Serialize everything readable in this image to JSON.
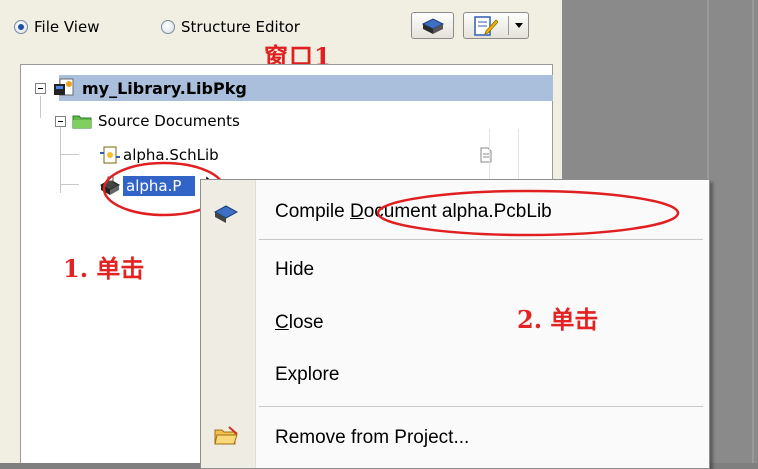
{
  "view_options": {
    "file_view_label": "File View",
    "structure_editor_label": "Structure Editor",
    "selected": "File View"
  },
  "annotations": {
    "window_label": "窗口1",
    "step1": "1. 单击",
    "step2": "2. 单击"
  },
  "tree": {
    "project": "my_Library.LibPkg",
    "folder": "Source Documents",
    "files": [
      {
        "name": "alpha.SchLib",
        "icon": "schlib-icon"
      },
      {
        "name": "alpha.P",
        "icon": "pcblib-icon",
        "selected": true
      }
    ]
  },
  "context_menu": {
    "compile": {
      "prefix": "Compile ",
      "accel": "D",
      "rest": "ocument alpha.PcbLib"
    },
    "hide": "Hide",
    "close": {
      "accel": "C",
      "rest": "lose"
    },
    "explore": "Explore",
    "remove": "Remove from Project..."
  },
  "colors": {
    "selection": "#3264c8",
    "annotation_red": "#e02020",
    "panel_bg": "#f1efe2",
    "header_row_bg": "#a9bfdc"
  }
}
